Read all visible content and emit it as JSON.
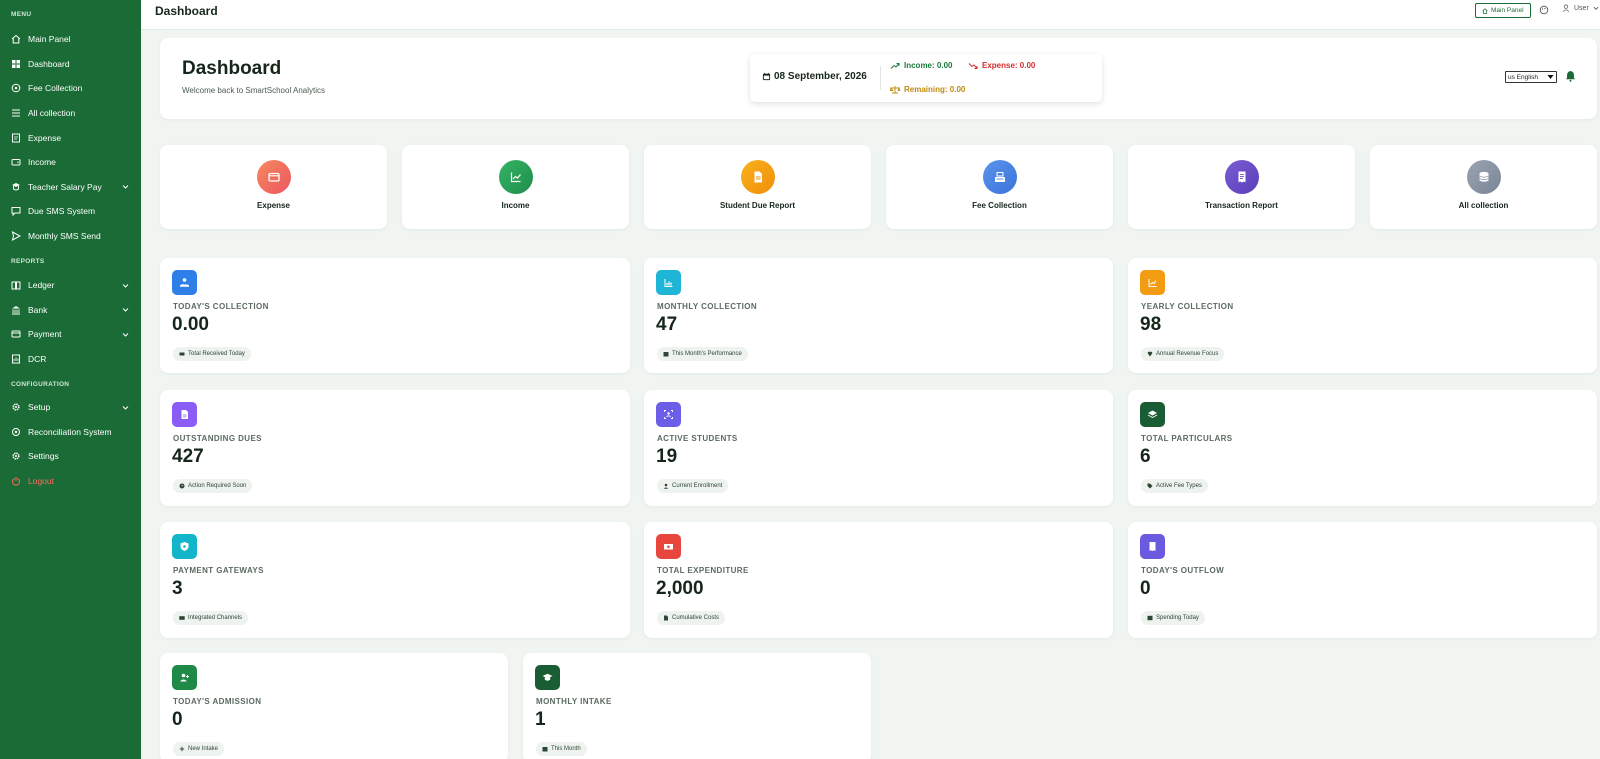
{
  "sidebar": {
    "sections": [
      "MENU",
      "REPORTS",
      "CONFIGURATION"
    ],
    "menu": [
      {
        "label": "Main Panel",
        "icon": "home-icon"
      },
      {
        "label": "Dashboard",
        "icon": "dashboard-icon"
      },
      {
        "label": "Fee Collection",
        "icon": "coin-icon"
      },
      {
        "label": "All collection",
        "icon": "list-icon"
      },
      {
        "label": "Expense",
        "icon": "receipt-icon"
      },
      {
        "label": "Income",
        "icon": "wallet-icon"
      },
      {
        "label": "Teacher Salary Pay",
        "icon": "teacher-icon"
      },
      {
        "label": "Due SMS System",
        "icon": "message-icon"
      },
      {
        "label": "Monthly SMS Send",
        "icon": "send-icon"
      }
    ],
    "reports": [
      {
        "label": "Ledger",
        "icon": "book-icon"
      },
      {
        "label": "Bank",
        "icon": "bank-icon"
      },
      {
        "label": "Payment",
        "icon": "payment-icon"
      },
      {
        "label": "DCR",
        "icon": "report-icon"
      }
    ],
    "configuration": [
      {
        "label": "Setup",
        "icon": "gear-icon"
      },
      {
        "label": "Reconciliation System",
        "icon": "reconcile-icon"
      },
      {
        "label": "Settings",
        "icon": "settings-icon"
      },
      {
        "label": "Logout",
        "icon": "logout-icon"
      }
    ]
  },
  "topbar": {
    "title": "Dashboard",
    "main_panel_label": "Main Panel",
    "user_label": "User"
  },
  "header": {
    "title": "Dashboard",
    "subtitle": "Welcome back to SmartSchool Analytics",
    "date": "08 September, 2026",
    "income": "Income: 0.00",
    "expense": "Expense: 0.00",
    "remaining": "Remaining: 0.00",
    "language": "us English"
  },
  "quick_access": [
    {
      "label": "Expense",
      "color": "#f0685c",
      "icon": "wallet-icon"
    },
    {
      "label": "Income",
      "color": "#28a55a",
      "icon": "chart-line-icon"
    },
    {
      "label": "Student Due Report",
      "color": "#f5a20f",
      "icon": "document-icon"
    },
    {
      "label": "Fee Collection",
      "color": "#4a86e8",
      "icon": "cash-register-icon"
    },
    {
      "label": "Transaction Report",
      "color": "#6a4fc7",
      "icon": "receipt-icon"
    },
    {
      "label": "All collection",
      "color": "#8c97a6",
      "icon": "database-icon"
    }
  ],
  "stats": [
    {
      "label": "Today's Collection",
      "value": "0.00",
      "badge": "Total Received Today",
      "color": "#2f7fe8",
      "icon": "hand-coin-icon"
    },
    {
      "label": "Monthly Collection",
      "value": "47",
      "badge": "This Month's Performance",
      "color": "#1fb5d6",
      "icon": "bar-chart-icon"
    },
    {
      "label": "Yearly Collection",
      "value": "98",
      "badge": "Annual Revenue Focus",
      "color": "#f39c12",
      "icon": "line-chart-icon"
    },
    {
      "label": "Outstanding Dues",
      "value": "427",
      "badge": "Action Required Soon",
      "color": "#8b5cf6",
      "icon": "invoice-icon"
    },
    {
      "label": "Active Students",
      "value": "19",
      "badge": "Current Enrollment",
      "color": "#6d5ee8",
      "icon": "id-card-icon"
    },
    {
      "label": "Total Particulars",
      "value": "6",
      "badge": "Active Fee Types",
      "color": "#1a5c33",
      "icon": "layers-icon"
    },
    {
      "label": "Payment Gateways",
      "value": "3",
      "badge": "Integrated Channels",
      "color": "#12b5c9",
      "icon": "shield-icon"
    },
    {
      "label": "Total Expenditure",
      "value": "2,000",
      "badge": "Cumulative Costs",
      "color": "#e8453c",
      "icon": "money-icon"
    },
    {
      "label": "Today's Outflow",
      "value": "0",
      "badge": "Spending Today",
      "color": "#6a5ae0",
      "icon": "receipt-icon"
    },
    {
      "label": "Today's Admission",
      "value": "0",
      "badge": "New Intake",
      "color": "#1f8a45",
      "icon": "user-plus-icon"
    },
    {
      "label": "Monthly Intake",
      "value": "1",
      "badge": "This Month",
      "color": "#1a5c33",
      "icon": "graduation-cap-icon"
    }
  ]
}
